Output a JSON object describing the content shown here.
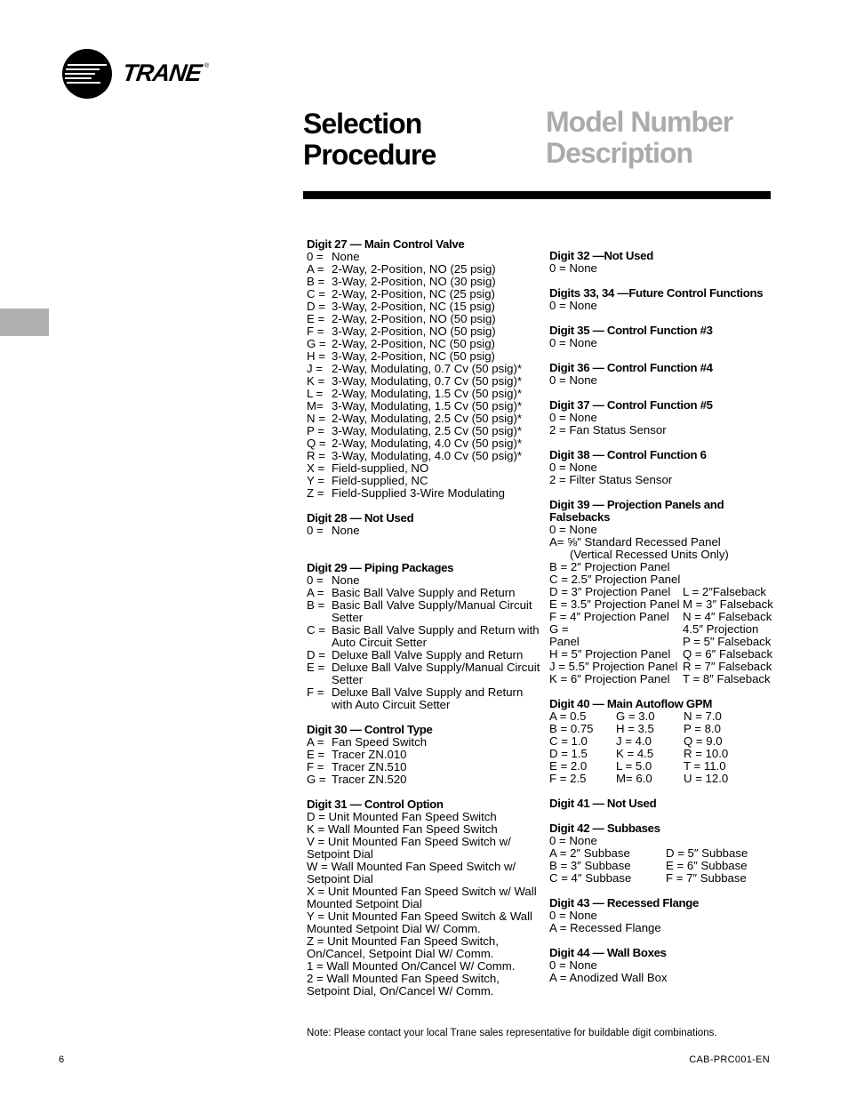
{
  "brand": {
    "name": "TRANE",
    "registered": "®"
  },
  "header": {
    "title_left": [
      "Selection",
      "Procedure"
    ],
    "title_right": [
      "Model Number",
      "Description"
    ]
  },
  "colors": {
    "title_right": "#ababab",
    "side_tab": "#b0b0b0",
    "rule": "#000000"
  },
  "left_column": [
    {
      "heading": "Digit 27 — Main Control Valve",
      "items": [
        [
          "0 =",
          "None"
        ],
        [
          "A =",
          "2-Way, 2-Position, NO (25 psig)"
        ],
        [
          "B =",
          "3-Way, 2-Position, NO (30 psig)"
        ],
        [
          "C =",
          "2-Way, 2-Position, NC (25 psig)"
        ],
        [
          "D =",
          "3-Way, 2-Position, NC (15 psig)"
        ],
        [
          "E =",
          "2-Way, 2-Position, NO (50 psig)"
        ],
        [
          "F =",
          "3-Way, 2-Position, NO (50 psig)"
        ],
        [
          "G =",
          "2-Way, 2-Position, NC (50 psig)"
        ],
        [
          "H =",
          "3-Way, 2-Position, NC (50 psig)"
        ],
        [
          "J =",
          "2-Way, Modulating, 0.7 Cv (50 psig)*"
        ],
        [
          "K =",
          "3-Way, Modulating, 0.7 Cv (50 psig)*"
        ],
        [
          "L =",
          "2-Way, Modulating, 1.5 Cv (50 psig)*"
        ],
        [
          "M=",
          "3-Way, Modulating, 1.5 Cv (50 psig)*"
        ],
        [
          "N =",
          "2-Way, Modulating, 2.5 Cv (50 psig)*"
        ],
        [
          "P =",
          "3-Way, Modulating, 2.5 Cv (50 psig)*"
        ],
        [
          "Q =",
          "2-Way, Modulating, 4.0 Cv (50 psig)*"
        ],
        [
          "R =",
          "3-Way, Modulating, 4.0 Cv (50 psig)*"
        ],
        [
          "X =",
          "Field-supplied, NO"
        ],
        [
          "Y =",
          "Field-supplied, NC"
        ],
        [
          "Z =",
          "Field-Supplied 3-Wire Modulating"
        ]
      ]
    },
    {
      "heading": "Digit 28 — Not Used",
      "items": [
        [
          "0 =",
          "None"
        ]
      ]
    },
    {
      "heading": "Digit 29 — Piping Packages",
      "items": [
        [
          "0 =",
          "None"
        ],
        [
          "A =",
          "Basic Ball Valve Supply and Return"
        ],
        [
          "B =",
          "Basic Ball Valve Supply/Manual Circuit Setter"
        ],
        [
          "C =",
          "Basic Ball Valve Supply and Return with Auto Circuit Setter"
        ],
        [
          "D =",
          "Deluxe Ball Valve Supply and Return"
        ],
        [
          "E =",
          "Deluxe Ball Valve Supply/Manual Circuit Setter"
        ],
        [
          "F =",
          "Deluxe Ball Valve Supply and Return with Auto Circuit Setter"
        ]
      ]
    },
    {
      "heading": "Digit 30 — Control Type",
      "items": [
        [
          "A =",
          "Fan Speed Switch"
        ],
        [
          "E =",
          "Tracer ZN.010"
        ],
        [
          "F =",
          "Tracer ZN.510"
        ],
        [
          "G =",
          "Tracer  ZN.520"
        ]
      ]
    },
    {
      "heading": "Digit 31 — Control Option",
      "lines": [
        "D =  Unit Mounted Fan Speed Switch",
        "K = Wall Mounted Fan Speed Switch",
        "V =  Unit Mounted Fan Speed Switch w/ Setpoint Dial",
        "W =  Wall Mounted  Fan Speed Switch w/ Setpoint Dial",
        "X =  Unit Mounted Fan Speed Switch w/ Wall Mounted Setpoint Dial",
        "Y =  Unit Mounted  Fan Speed Switch & Wall Mounted Setpoint Dial W/ Comm.",
        "Z =  Unit Mounted  Fan Speed Switch, On/Cancel, Setpoint Dial W/ Comm.",
        "1 =  Wall Mounted  On/Cancel W/ Comm.",
        "2 =  Wall Mounted  Fan Speed Switch, Setpoint Dial, On/Cancel W/ Comm."
      ]
    }
  ],
  "right_column": {
    "d32": {
      "heading": "Digit 32 —Not Used",
      "line": "0 = None"
    },
    "d33": {
      "heading": "Digits 33, 34 —Future Control Functions",
      "line": "0  = None"
    },
    "d35": {
      "heading": "Digit 35 — Control Function #3",
      "line": "0  =  None"
    },
    "d36": {
      "heading": "Digit 36 — Control Function #4",
      "line": "0  =  None"
    },
    "d37": {
      "heading": "Digit 37 — Control Function #5",
      "lines": [
        "0  =  None",
        "2  =  Fan Status Sensor"
      ]
    },
    "d38": {
      "heading": "Digit 38 — Control Function 6",
      "lines": [
        "0 = None",
        "2 = Filter Status Sensor"
      ]
    },
    "d39": {
      "heading": "Digit 39 — Projection Panels and Falsebacks",
      "none": "0 = None",
      "a_line": "A= ⅝″ Standard Recessed Panel",
      "a_sub": "(Vertical Recessed Units Only)",
      "b": "B = 2″ Projection Panel",
      "c": "C = 2.5″ Projection Panel",
      "pairs": [
        [
          "D = 3″ Projection Panel",
          "L  = 2″Falseback"
        ],
        [
          "E = 3.5″ Projection Panel",
          "M = 3″  Falseback"
        ],
        [
          "F = 4″ Projection Panel",
          "N = 4″  Falseback"
        ],
        [
          "G   =",
          "4.5″ Projection"
        ],
        [
          "Panel",
          "P  = 5″  Falseback"
        ],
        [
          "H = 5″ Projection Panel",
          "Q = 6″  Falseback"
        ],
        [
          "J = 5.5″ Projection Panel",
          "R  = 7″  Falseback"
        ],
        [
          "K = 6″ Projection Panel",
          "T  = 8″  Falseback"
        ]
      ]
    },
    "d40": {
      "heading": "Digit 40 — Main Autoflow GPM",
      "rows": [
        [
          "A =  0.5",
          "G =  3.0",
          "N =  7.0"
        ],
        [
          "B =  0.75",
          "H =  3.5",
          "P =  8.0"
        ],
        [
          "C =  1.0",
          "J =  4.0",
          "Q =  9.0"
        ],
        [
          "D =  1.5",
          "K =  4.5",
          "R =  10.0"
        ],
        [
          "E =  2.0",
          "L =  5.0",
          "T =  11.0"
        ],
        [
          "F =  2.5",
          "M=  6.0",
          "U =  12.0"
        ]
      ]
    },
    "d41": {
      "heading": "Digit 41 — Not Used"
    },
    "d42": {
      "heading": "Digit 42 — Subbases",
      "none": "0  =  None",
      "rows": [
        [
          "A =  2″ Subbase",
          "D = 5″ Subbase"
        ],
        [
          "B =  3″ Subbase",
          "E = 6″ Subbase"
        ],
        [
          "C =  4″ Subbase",
          "F = 7″ Subbase"
        ]
      ]
    },
    "d43": {
      "heading": "Digit 43 — Recessed Flange",
      "lines": [
        "0  =  None",
        "A =  Recessed Flange"
      ]
    },
    "d44": {
      "heading": "Digit 44 — Wall Boxes",
      "lines": [
        "0  =  None",
        "A =  Anodized Wall Box"
      ]
    }
  },
  "footer": {
    "note": "Note: Please contact your local Trane sales representative for buildable digit combinations.",
    "page_number": "6",
    "doc_id": "CAB-PRC001-EN"
  }
}
